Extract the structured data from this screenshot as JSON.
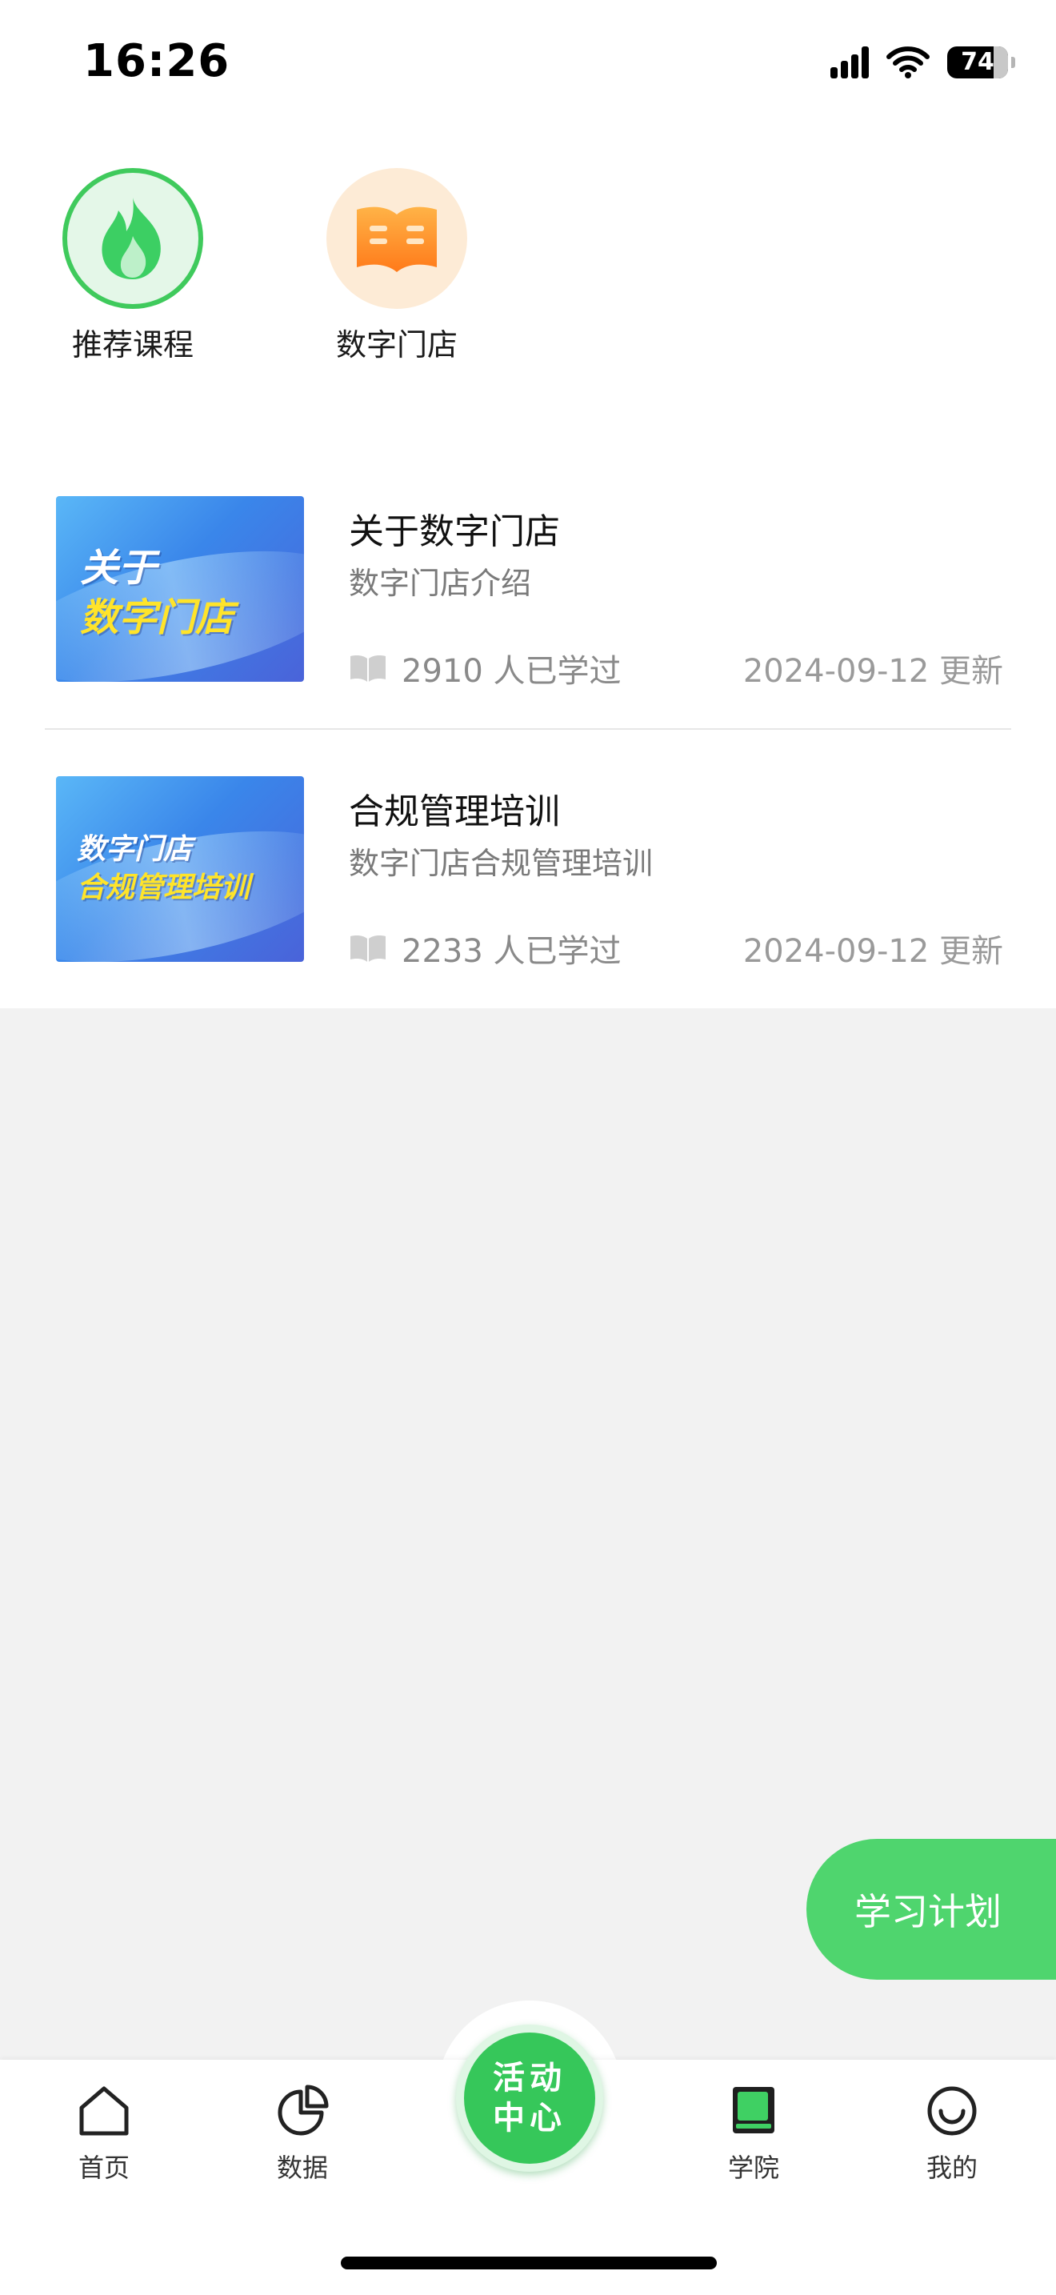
{
  "status_bar": {
    "time": "16:26",
    "battery": "74"
  },
  "categories": [
    {
      "label": "推荐课程",
      "icon": "flame-icon"
    },
    {
      "label": "数字门店",
      "icon": "book-icon"
    }
  ],
  "courses": [
    {
      "title": "关于数字门店",
      "subtitle": "数字门店介绍",
      "learners": "2910 人已学过",
      "updated": "2024-09-12 更新",
      "thumb_line1": "关于",
      "thumb_line2": "数字门店"
    },
    {
      "title": "合规管理培训",
      "subtitle": "数字门店合规管理培训",
      "learners": "2233 人已学过",
      "updated": "2024-09-12 更新",
      "thumb_line1": "数字门店",
      "thumb_line2": "合规管理培训"
    }
  ],
  "floating_button": {
    "label": "学习计划"
  },
  "tabbar": {
    "home": "首页",
    "data": "数据",
    "center_line1": "活动",
    "center_line2": "中心",
    "academy": "学院",
    "mine": "我的"
  },
  "colors": {
    "accent": "#3fca5c",
    "plan_button": "#4fd56e",
    "background": "#f2f2f2"
  }
}
